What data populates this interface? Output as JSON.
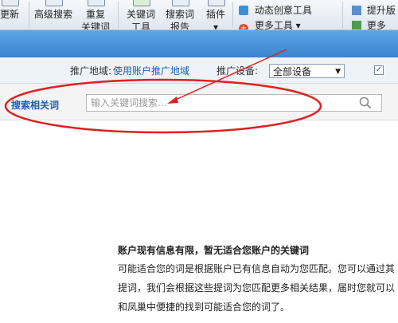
{
  "toolbar": {
    "items": [
      {
        "l1": "更新",
        "l2": ""
      },
      {
        "l1": "高级搜索",
        "l2": ""
      },
      {
        "l1": "重复",
        "l2": "关键词"
      },
      {
        "l1": "关键词",
        "l2": "工具"
      },
      {
        "l1": "搜索词",
        "l2": "报告"
      },
      {
        "l1": "插件",
        "l2": "▾"
      }
    ],
    "creative_tool": "动态创意工具",
    "more_tools": "更多工具 ▾",
    "upgrade": "提升版",
    "more_right": "更多",
    "colors": {
      "accent": "#3a85cc",
      "link": "#1a5fb4",
      "annotation": "#e02020"
    }
  },
  "filter": {
    "region_label": "推广地域:",
    "region_value": "使用账户推广地域",
    "device_label": "推广设备:",
    "device_value": "全部设备",
    "checkbox_checked": true
  },
  "search": {
    "label": "搜索相关词",
    "placeholder": "输入关键词搜索...",
    "icon": "search-icon"
  },
  "message": {
    "title": "账户现有信息有限，暂无适合您账户的关键词",
    "line1": "可能适合您的词是根据账户已有信息自动为您匹配。您可以通过其",
    "line2": "提词，我们会根据这些提词为您匹配更多相关结果，届时您就可以",
    "line3": "和凤巢中便捷的找到可能适合您的词了。"
  }
}
